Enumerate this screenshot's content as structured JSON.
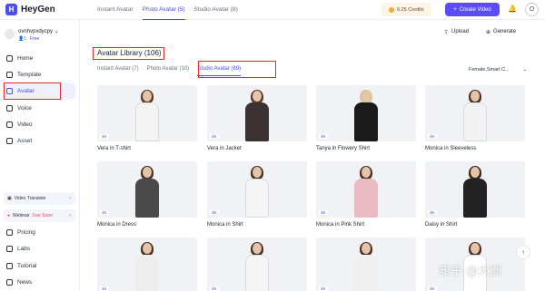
{
  "app": {
    "name": "HeyGen",
    "logo_letter": "H"
  },
  "top_tabs": [
    {
      "label": "Instant Avatar",
      "active": false
    },
    {
      "label": "Photo Avatar (5)",
      "active": true
    },
    {
      "label": "Studio Avatar (8)",
      "active": false
    }
  ],
  "header": {
    "credits": "6.25 Credits",
    "create_label": "Create Video",
    "user_initial": "O"
  },
  "sidebar": {
    "workspace": {
      "name": "ovnhvpxdycpy",
      "members": "1",
      "plan": "Free"
    },
    "items": [
      {
        "label": "Home",
        "icon": "home-icon",
        "active": false
      },
      {
        "label": "Template",
        "icon": "template-icon",
        "active": false
      },
      {
        "label": "Avatar",
        "icon": "avatar-icon",
        "active": true
      },
      {
        "label": "Voice",
        "icon": "voice-icon",
        "active": false
      },
      {
        "label": "Video",
        "icon": "video-icon",
        "active": false
      },
      {
        "label": "Asset",
        "icon": "asset-icon",
        "active": false
      }
    ],
    "promos": [
      {
        "label": "Video Translate",
        "live": ""
      },
      {
        "label": "Webinar",
        "live": "Live Soon"
      }
    ],
    "bottom_items": [
      {
        "label": "Pricing",
        "icon": "pricing-icon"
      },
      {
        "label": "Labs",
        "icon": "labs-icon"
      },
      {
        "label": "Tutorial",
        "icon": "tutorial-icon"
      },
      {
        "label": "News",
        "icon": "news-icon"
      }
    ]
  },
  "toolbar": {
    "upload_label": "Upload",
    "generate_label": "Generate"
  },
  "library": {
    "title": "Avatar Library (106)",
    "tabs": [
      {
        "label": "Instant Avatar (7)",
        "active": false
      },
      {
        "label": "Photo Avatar (10)",
        "active": false
      },
      {
        "label": "Studio Avatar (89)",
        "active": true
      }
    ],
    "filter": "Female,Smart C..."
  },
  "avatars": [
    {
      "name": "Vera in T-shirt",
      "badge": "4K",
      "outfit": "#f4f4f4",
      "hair": "#5a3b26"
    },
    {
      "name": "Vera in Jacket",
      "badge": "4K",
      "outfit": "#3b3130",
      "hair": "#5a3b26"
    },
    {
      "name": "Tanya in Flowery Shirt",
      "badge": "4K",
      "outfit": "#1a1a1a",
      "hair": "#d7c59a"
    },
    {
      "name": "Monica in Sleeveless",
      "badge": "4K",
      "outfit": "#f2f2f2",
      "hair": "#4a3222"
    },
    {
      "name": "Monica in Dress",
      "badge": "4K",
      "outfit": "#4a4a4a",
      "hair": "#4a3222"
    },
    {
      "name": "Monica in Shirt",
      "badge": "4K",
      "outfit": "#f5f5f5",
      "hair": "#4a3222"
    },
    {
      "name": "Monica in Pink Shirt",
      "badge": "4K",
      "outfit": "#e9b9c4",
      "hair": "#4a3222"
    },
    {
      "name": "Daisy in Shirt",
      "badge": "4K",
      "outfit": "#222222",
      "hair": "#3a2518"
    },
    {
      "name": "",
      "badge": "4K",
      "outfit": "#eeeeee",
      "hair": "#4a3222"
    },
    {
      "name": "",
      "badge": "4K",
      "outfit": "#f5f5f5",
      "hair": "#4a3222"
    },
    {
      "name": "",
      "badge": "4K",
      "outfit": "#f0f0f0",
      "hair": "#4a3222"
    },
    {
      "name": "",
      "badge": "4K",
      "outfit": "#ffffff",
      "hair": "#4a3222"
    }
  ],
  "watermark": "知乎 @大洲",
  "colors": {
    "accent": "#4c4cf5",
    "highlight_box": "#e22c2c"
  }
}
